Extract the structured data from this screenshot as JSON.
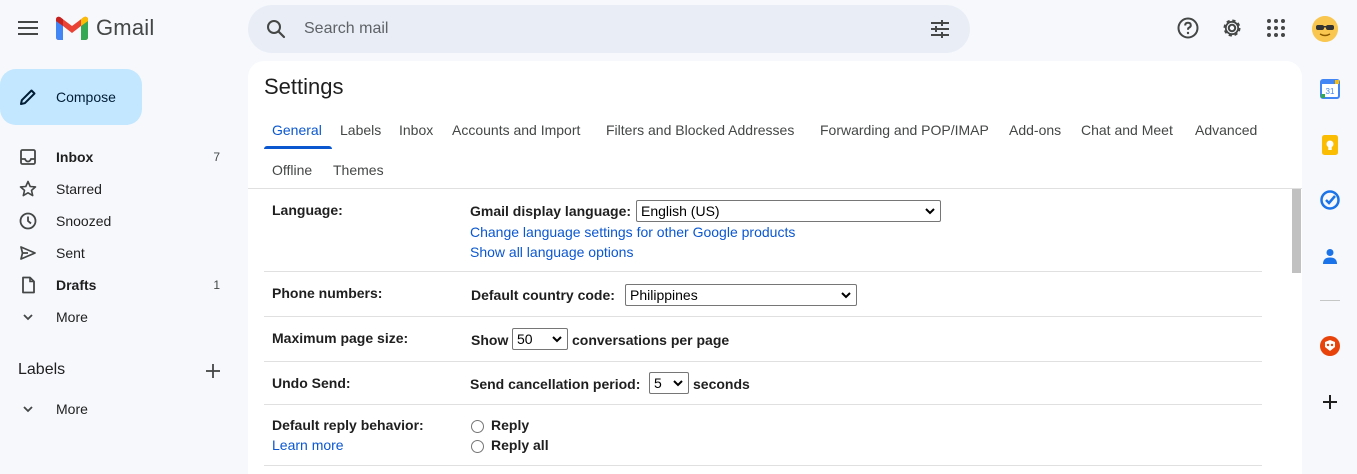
{
  "app": {
    "name": "Gmail"
  },
  "search": {
    "placeholder": "Search mail"
  },
  "compose": {
    "label": "Compose"
  },
  "nav": {
    "items": [
      {
        "label": "Inbox",
        "count": "7",
        "icon": "inbox-icon",
        "bold": true
      },
      {
        "label": "Starred",
        "count": "",
        "icon": "star-icon",
        "bold": false
      },
      {
        "label": "Snoozed",
        "count": "",
        "icon": "clock-icon",
        "bold": false
      },
      {
        "label": "Sent",
        "count": "",
        "icon": "send-icon",
        "bold": false
      },
      {
        "label": "Drafts",
        "count": "1",
        "icon": "draft-icon",
        "bold": true
      },
      {
        "label": "More",
        "count": "",
        "icon": "chevron-down-icon",
        "bold": false
      }
    ],
    "labels_heading": "Labels",
    "labels_more": "More"
  },
  "settings": {
    "title": "Settings",
    "tabs": [
      "General",
      "Labels",
      "Inbox",
      "Accounts and Import",
      "Filters and Blocked Addresses",
      "Forwarding and POP/IMAP",
      "Add-ons",
      "Chat and Meet",
      "Advanced",
      "Offline",
      "Themes"
    ],
    "active_tab": "General",
    "language": {
      "label": "Language:",
      "display_label": "Gmail display language:",
      "value": "English (US)",
      "link1": "Change language settings for other Google products",
      "link2": "Show all language options"
    },
    "phone": {
      "label": "Phone numbers:",
      "country_label": "Default country code:",
      "value": "Philippines"
    },
    "page_size": {
      "label": "Maximum page size:",
      "prefix": "Show",
      "value": "50",
      "suffix": "conversations per page"
    },
    "undo_send": {
      "label": "Undo Send:",
      "period_label": "Send cancellation period:",
      "value": "5",
      "suffix": "seconds"
    },
    "reply": {
      "label": "Default reply behavior:",
      "learn_more": "Learn more",
      "options": [
        "Reply",
        "Reply all"
      ]
    }
  },
  "colors": {
    "accent": "#0b57d0",
    "compose_bg": "#c2e7ff",
    "search_bg": "#e9eef6",
    "page_bg": "#f6f8fc"
  },
  "side_panel": [
    "calendar-icon",
    "keep-icon",
    "tasks-icon",
    "contacts-icon",
    "addon-icon",
    "add-icon"
  ]
}
